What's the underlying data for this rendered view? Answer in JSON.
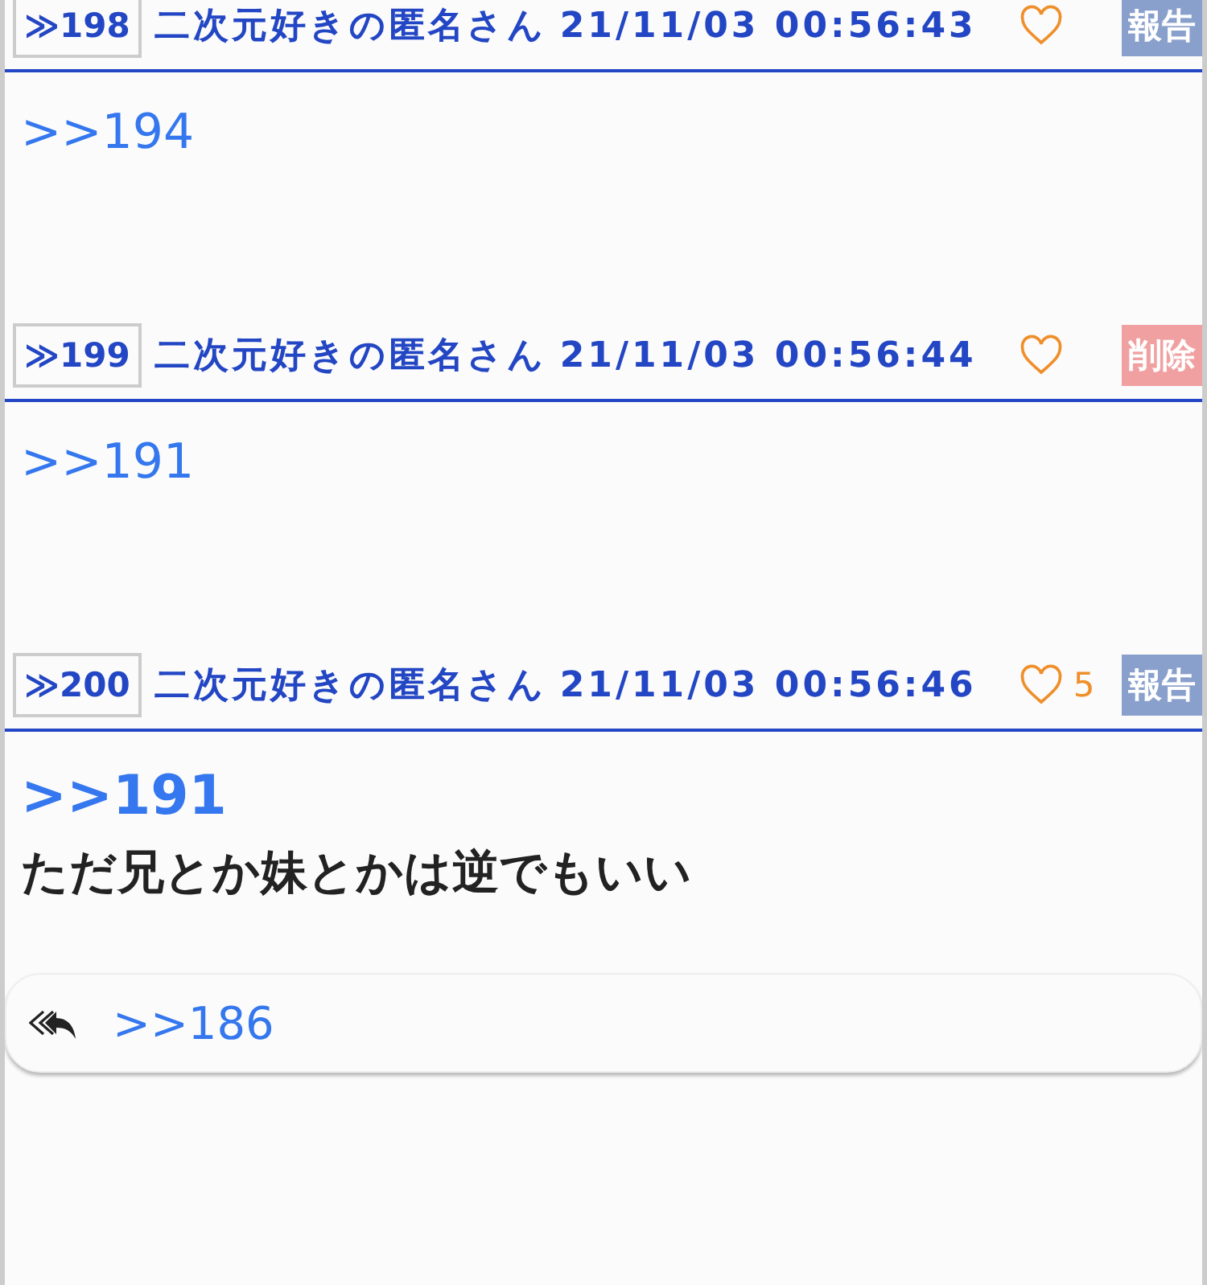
{
  "posts": [
    {
      "number": "≫198",
      "name": "二次元好きの匿名さん",
      "date": "21/11/03 00:56:43",
      "action": {
        "kind": "report",
        "label": "報告"
      },
      "body": [
        {
          "kind": "link",
          "text": ">>194"
        }
      ]
    },
    {
      "number": "≫199",
      "name": "二次元好きの匿名さん",
      "date": "21/11/03 00:56:44",
      "action": {
        "kind": "delete",
        "label": "削除"
      },
      "body": [
        {
          "kind": "link",
          "text": ">>191"
        }
      ]
    },
    {
      "number": "≫200",
      "name": "二次元好きの匿名さん",
      "date": "21/11/03 00:56:46",
      "likes": "5",
      "action": {
        "kind": "report",
        "label": "報告"
      },
      "body": [
        {
          "kind": "big_link",
          "text": ">>191"
        },
        {
          "kind": "text",
          "text": "ただ兄とか妹とかは逆でもいい"
        }
      ]
    }
  ],
  "reply_bar": {
    "text": ">>186"
  }
}
